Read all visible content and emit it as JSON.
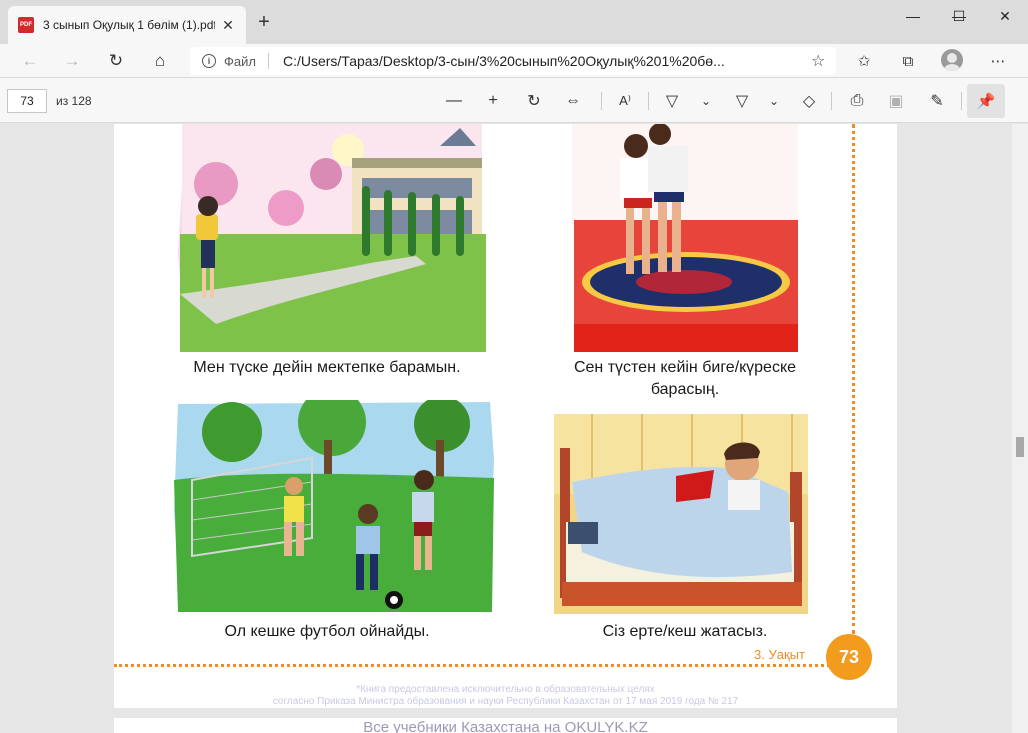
{
  "browser": {
    "tab_title": "3 сынып Оқулық 1 бөлім (1).pdf",
    "tab_icon_text": "PDF",
    "file_label": "Файл",
    "url": "C:/Users/Тараз/Desktop/3-сын/3%20сынып%20Оқулық%201%20бө..."
  },
  "pdf_toolbar": {
    "page_number": "73",
    "page_count": "из 128"
  },
  "page": {
    "captions": [
      "Мен түске дейін мектепке барамын.",
      "Сен түстен кейін биге/күреске",
      "барасың.",
      "Ол кешке футбол ойнайды.",
      "Сіз ерте/кеш жатасыз."
    ],
    "chapter": "3. Уақыт",
    "page_badge": "73",
    "footnote_line1": "*Книга предоставлена исключительно в образовательных целях",
    "footnote_line2": "согласно Приказа Министра образования и науки Республики Казахстан от 17 мая 2019 года № 217",
    "next_page_watermark": "Все учебники Казахстана на OKULYK.KZ"
  },
  "colors": {
    "accent_orange": "#f08c21",
    "badge_orange": "#f39b1c"
  }
}
